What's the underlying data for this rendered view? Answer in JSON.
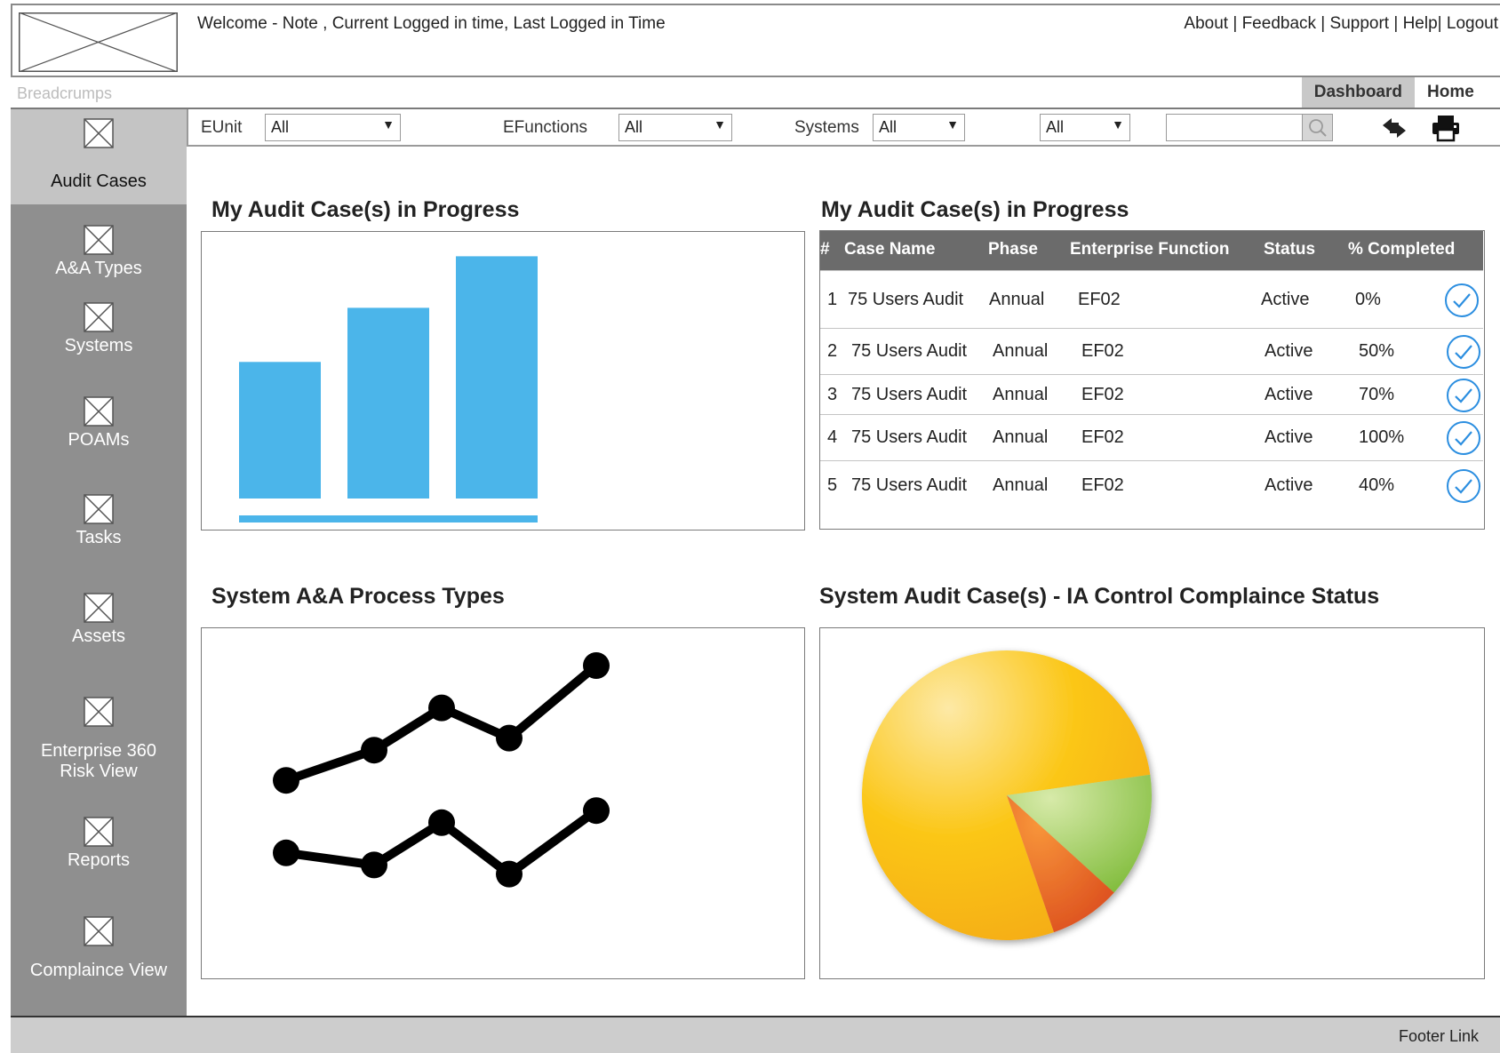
{
  "header": {
    "welcome": "Welcome - Note , Current Logged in time, Last Logged in Time",
    "links": [
      "About",
      "Feedback",
      "Support",
      "Help",
      "Logout"
    ]
  },
  "breadcrumbs": "Breadcrumps",
  "tabs": {
    "dashboard": "Dashboard",
    "home": "Home"
  },
  "sidebar": {
    "items": [
      {
        "label": "Audit Cases",
        "icon": "image-placeholder-icon",
        "active": true
      },
      {
        "label": "A&A Types",
        "icon": "image-placeholder-icon"
      },
      {
        "label": "Systems",
        "icon": "image-placeholder-icon"
      },
      {
        "label": "POAMs",
        "icon": "image-placeholder-icon"
      },
      {
        "label": "Tasks",
        "icon": "image-placeholder-icon"
      },
      {
        "label": "Assets",
        "icon": "image-placeholder-icon"
      },
      {
        "label": "Enterprise 360",
        "label2": "Risk View",
        "icon": "image-placeholder-icon"
      },
      {
        "label": "Reports",
        "icon": "image-placeholder-icon"
      },
      {
        "label": "Complaince View",
        "icon": "image-placeholder-icon"
      }
    ]
  },
  "filters": {
    "eunit": {
      "label": "EUnit",
      "value": "All"
    },
    "efunctions": {
      "label": "EFunctions",
      "value": "All"
    },
    "systems": {
      "label": "Systems",
      "value": "All"
    },
    "extra": {
      "value": "All"
    },
    "search": {
      "value": "",
      "icon": "search-icon"
    },
    "refresh_icon": "refresh-arrows-icon",
    "print_icon": "printer-icon"
  },
  "panels": {
    "bar_title": "My Audit Case(s) in Progress",
    "table_title": "My Audit Case(s) in Progress",
    "line_title": "System A&A Process Types",
    "pie_title": "System Audit Case(s) - IA Control Complaince Status"
  },
  "table": {
    "columns": [
      "#",
      "Case Name",
      "Phase",
      "Enterprise Function",
      "Status",
      "% Completed"
    ],
    "rows": [
      {
        "num": "1",
        "case": "75 Users Audit",
        "phase": "Annual",
        "ef": "EF02",
        "status": "Active",
        "pct": "0%"
      },
      {
        "num": "2",
        "case": "75 Users Audit",
        "phase": "Annual",
        "ef": "EF02",
        "status": "Active",
        "pct": "50%"
      },
      {
        "num": "3",
        "case": "75 Users Audit",
        "phase": "Annual",
        "ef": "EF02",
        "status": "Active",
        "pct": "70%"
      },
      {
        "num": "4",
        "case": "75 Users Audit",
        "phase": "Annual",
        "ef": "EF02",
        "status": "Active",
        "pct": "100%"
      },
      {
        "num": "5",
        "case": "75 Users Audit",
        "phase": "Annual",
        "ef": "EF02",
        "status": "Active",
        "pct": "40%"
      }
    ],
    "check_icon": "check-circle-icon"
  },
  "footer": {
    "link": "Footer Link"
  },
  "colors": {
    "bar": "#4bb5ea",
    "sidebar": "#8f8f8f",
    "sidebar_active": "#c4c4c4",
    "table_header": "#6b6b6b",
    "check": "#2b8ee0",
    "pie_large": "#f7b500",
    "pie_green": "#8cc43f",
    "pie_orange": "#ea6b1e"
  },
  "chart_data": [
    {
      "type": "bar",
      "categories": [
        "",
        "",
        ""
      ],
      "values": [
        53,
        74,
        94
      ],
      "ylim": [
        0,
        100
      ],
      "grid": false,
      "title": ""
    },
    {
      "type": "line",
      "x": [
        1,
        2,
        3,
        4,
        5
      ],
      "series": [
        {
          "values": [
            52,
            62,
            76,
            66,
            90
          ]
        },
        {
          "values": [
            28,
            24,
            38,
            21,
            42
          ]
        }
      ],
      "ylim": [
        0,
        100
      ],
      "grid": false,
      "title": ""
    },
    {
      "type": "pie",
      "values": [
        78,
        14,
        8
      ],
      "colors": [
        "#f7b500",
        "#8cc43f",
        "#ea6b1e"
      ],
      "title": ""
    }
  ]
}
